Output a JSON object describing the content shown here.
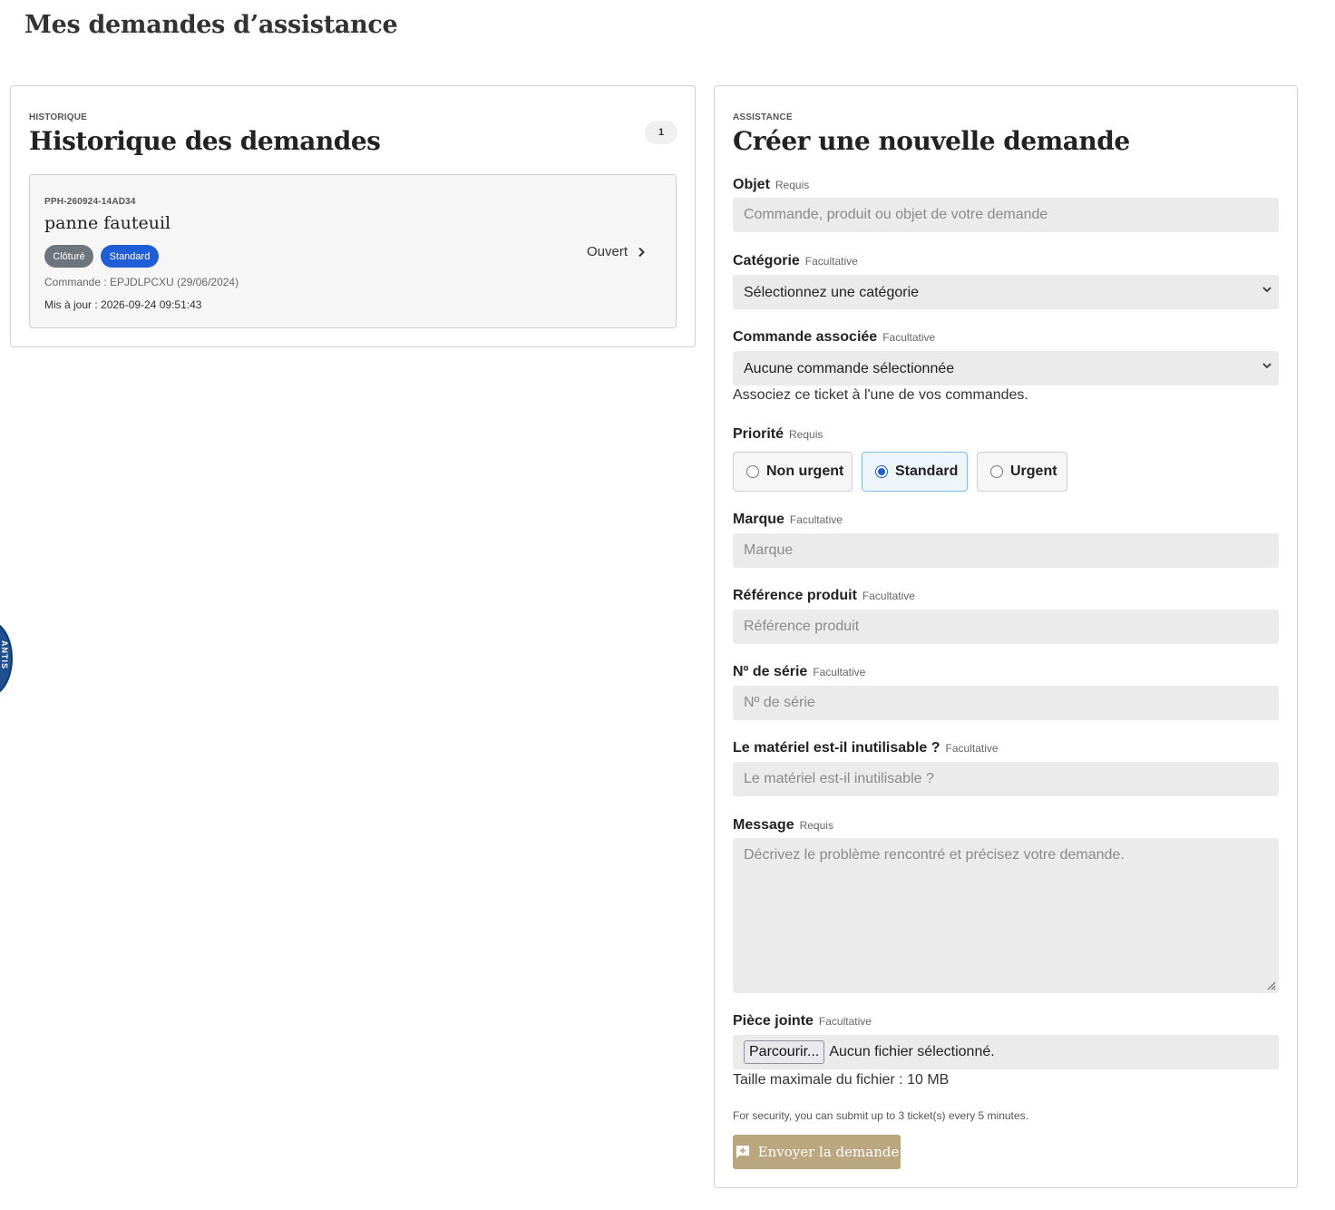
{
  "page": {
    "title": "Mes demandes d’assistance"
  },
  "seal": {
    "text": "ANTIS"
  },
  "history": {
    "eyebrow": "HISTORIQUE",
    "heading": "Historique des demandes",
    "count": "1",
    "tickets": [
      {
        "id": "PPH-260924-14AD34",
        "title": "panne fauteuil",
        "badges": [
          "Clôturé",
          "Standard"
        ],
        "order": "Commande : EPJDLPCXU (29/06/2024)",
        "updated": "Mis à jour : 2026-09-24 09:51:43",
        "status": "Ouvert"
      }
    ]
  },
  "form": {
    "eyebrow": "ASSISTANCE",
    "heading": "Créer une nouvelle demande",
    "tags": {
      "required": "Requis",
      "optional": "Facultative"
    },
    "subject": {
      "label": "Objet",
      "placeholder": "Commande, produit ou objet de votre demande"
    },
    "category": {
      "label": "Catégorie",
      "selected": "Sélectionnez une catégorie"
    },
    "order": {
      "label": "Commande associée",
      "selected": "Aucune commande sélectionnée",
      "help": "Associez ce ticket à l'une de vos commandes."
    },
    "priority": {
      "label": "Priorité",
      "options": [
        "Non urgent",
        "Standard",
        "Urgent"
      ],
      "selected": "Standard"
    },
    "brand": {
      "label": "Marque",
      "placeholder": "Marque"
    },
    "product_ref": {
      "label": "Référence produit",
      "placeholder": "Référence produit"
    },
    "serial": {
      "label": "Nº de série",
      "placeholder": "Nº de série"
    },
    "unusable": {
      "label": "Le matériel est-il inutilisable ?",
      "placeholder": "Le matériel est-il inutilisable ?"
    },
    "message": {
      "label": "Message",
      "placeholder": "Décrivez le problème rencontré et précisez votre demande."
    },
    "attachment": {
      "label": "Pièce jointe",
      "button": "Parcourir...",
      "status": "Aucun fichier sélectionné.",
      "help": "Taille maximale du fichier : 10 MB"
    },
    "security_note": "For security, you can submit up to 3 ticket(s) every 5 minutes.",
    "submit": "Envoyer la demande"
  },
  "colors": {
    "accent_gold": "#bba77f",
    "badge_blue": "#1f5ed6",
    "badge_gray": "#6c757d",
    "radio_active_border": "#7fbfe6"
  }
}
